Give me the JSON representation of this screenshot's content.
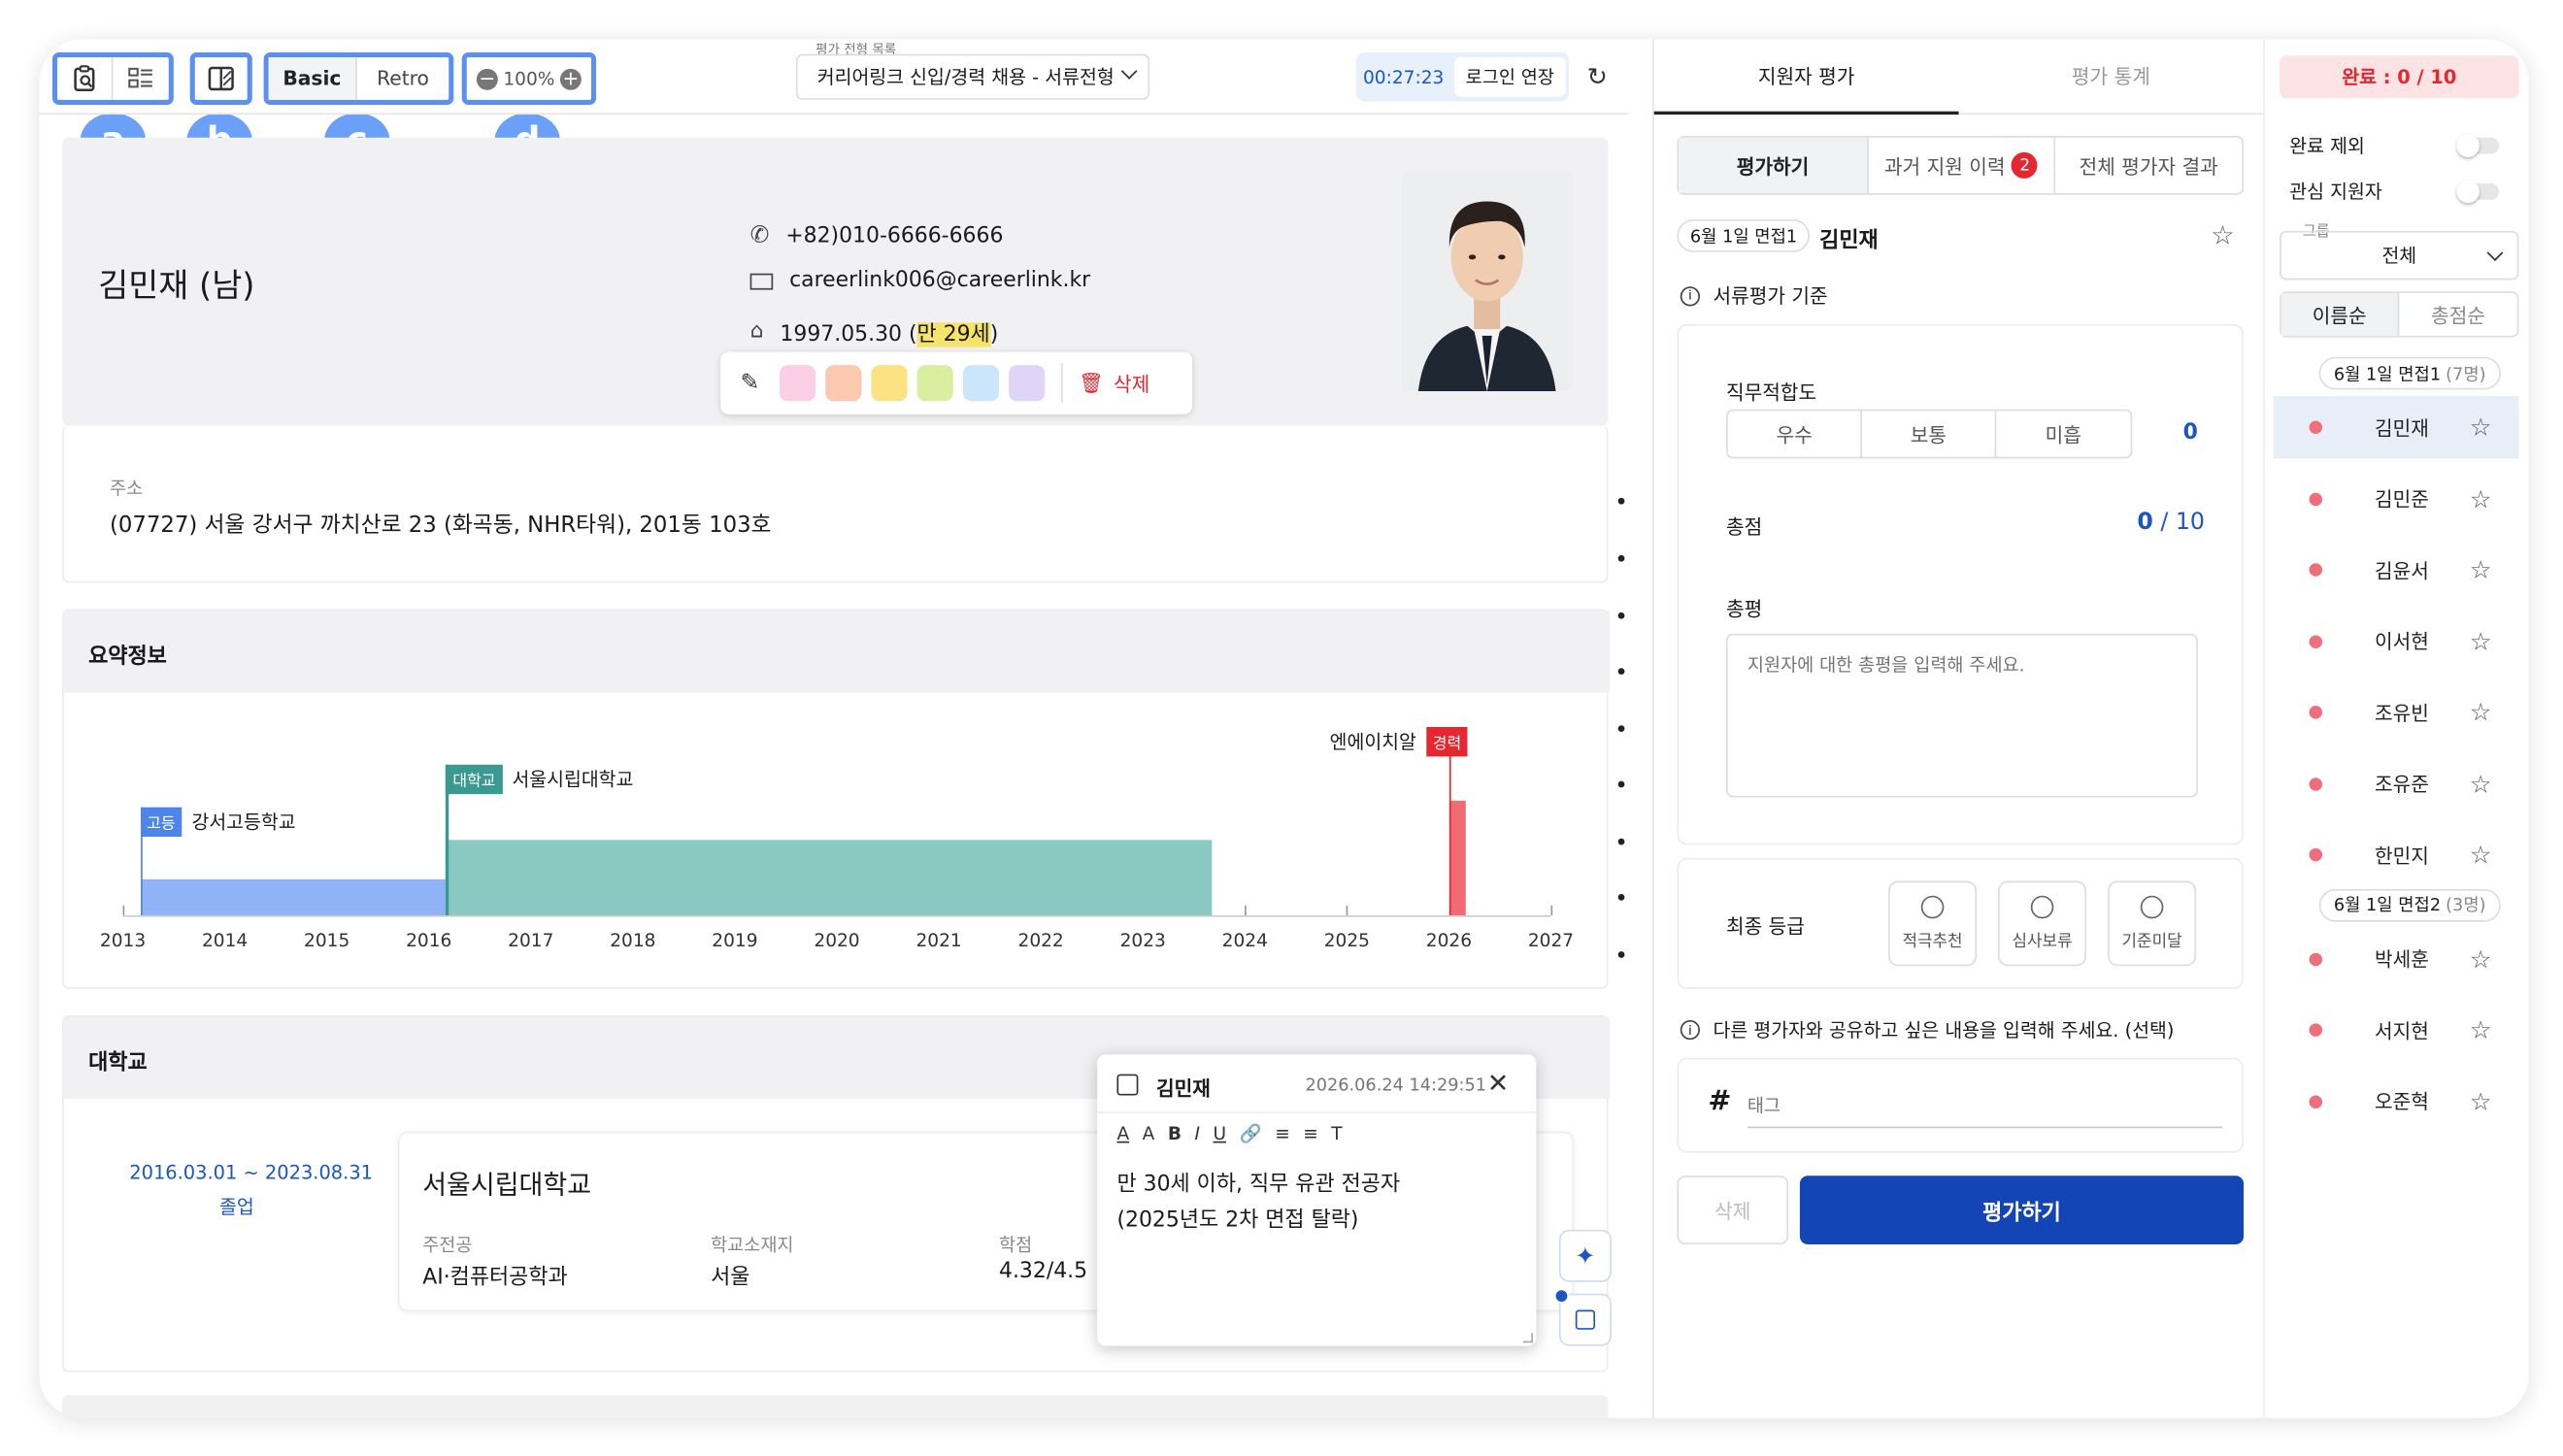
{
  "toolbar": {
    "view_basic": "Basic",
    "view_retro": "Retro",
    "zoom": "100%",
    "callouts": [
      "a",
      "b",
      "c",
      "d"
    ],
    "list_caption": "평가 전형 목록",
    "list_value": "커리어링크 신입/경력 채용 - 서류전형",
    "timer": "00:27:23",
    "extend_login": "로그인 연장"
  },
  "profile": {
    "name": "김민재 (남)",
    "phone": "+82)010-6666-6666",
    "email": "careerlink006@careerlink.kr",
    "birth_prefix": "1997.05.30 (",
    "birth_age": "만 29세",
    "birth_suffix": ")",
    "delete_label": "삭제",
    "memo_colors": [
      "#fbd0e6",
      "#fbc9b0",
      "#fbe283",
      "#d9ef9f",
      "#cbe6fb",
      "#e0d4f9"
    ],
    "address_label": "주소",
    "address": "(07727) 서울 강서구 까치산로 23 (화곡동, NHR타워), 201동 103호"
  },
  "summary": {
    "title": "요약정보",
    "chart_data": {
      "type": "timeline",
      "x_ticks": [
        "2013",
        "2014",
        "2015",
        "2016",
        "2017",
        "2018",
        "2019",
        "2020",
        "2021",
        "2022",
        "2023",
        "2024",
        "2025",
        "2026",
        "2027"
      ],
      "xlim": [
        2013,
        2027
      ],
      "series": [
        {
          "tag": "고등",
          "name": "강서고등학교",
          "start": 2013.17,
          "end": 2016.17,
          "color": "#8fb3f4",
          "tag_color": "#4d86ea"
        },
        {
          "tag": "대학교",
          "name": "서울시립대학교",
          "start": 2016.17,
          "end": 2023.67,
          "color": "#8ac8c2",
          "tag_color": "#3a9a92"
        },
        {
          "tag": "경력",
          "name": "엔에이치알",
          "start": 2026.0,
          "end": 2026.17,
          "color": "#f26b73",
          "tag_color": "#e8262f"
        }
      ]
    }
  },
  "university": {
    "section_title": "대학교",
    "period": "2016.03.01 ~ 2023.08.31",
    "status": "졸업",
    "school": "서울시립대학교",
    "major_label": "주전공",
    "major": "AI·컴퓨터공학과",
    "location_label": "학교소재지",
    "location": "서울",
    "gpa_label": "학점",
    "gpa": "4.32/4.5"
  },
  "memo": {
    "author": "김민재",
    "timestamp": "2026.06.24 14:29:51",
    "format_icons": [
      "A",
      "A",
      "B",
      "I",
      "U",
      "🔗",
      "≡",
      "≡",
      "T"
    ],
    "line1": "만 30세 이하, 직무 유관 전공자",
    "line2": "(2025년도 2차 면접 탈락)"
  },
  "eval": {
    "tab_eval": "지원자 평가",
    "tab_stats": "평가 통계",
    "sub_eval": "평가하기",
    "sub_history": "과거 지원 이력",
    "sub_history_badge": "2",
    "sub_all": "전체 평가자 결과",
    "group_tag": "6월 1일 면접1",
    "candidate": "김민재",
    "criteria": "서류평가 기준",
    "fit_label": "직무적합도",
    "fit_options": [
      "우수",
      "보통",
      "미흡"
    ],
    "fit_score": "0",
    "total_label": "총점",
    "total_score": "0",
    "total_max": "/ 10",
    "review_label": "총평",
    "review_placeholder": "지원자에 대한 총평을 입력해 주세요.",
    "grade_label": "최종 등급",
    "grades": [
      "적극추천",
      "심사보류",
      "기준미달"
    ],
    "share_note": "다른 평가자와 공유하고 싶은 내용을 입력해 주세요. (선택)",
    "tag_placeholder": "태그",
    "delete": "삭제",
    "submit": "평가하기"
  },
  "sidebar": {
    "done": "완료 : 0 / 10",
    "exclude_done": "완료 제외",
    "favorite": "관심 지원자",
    "group_label": "그룹",
    "group_value": "전체",
    "sort_name": "이름순",
    "sort_score": "총점순",
    "groups": [
      {
        "label": "6월 1일 면접1",
        "count": "(7명)",
        "members": [
          "김민재",
          "김민준",
          "김윤서",
          "이서현",
          "조유빈",
          "조유준",
          "한민지"
        ]
      },
      {
        "label": "6월 1일 면접2",
        "count": "(3명)",
        "members": [
          "박세훈",
          "서지현",
          "오준혁"
        ]
      }
    ]
  }
}
